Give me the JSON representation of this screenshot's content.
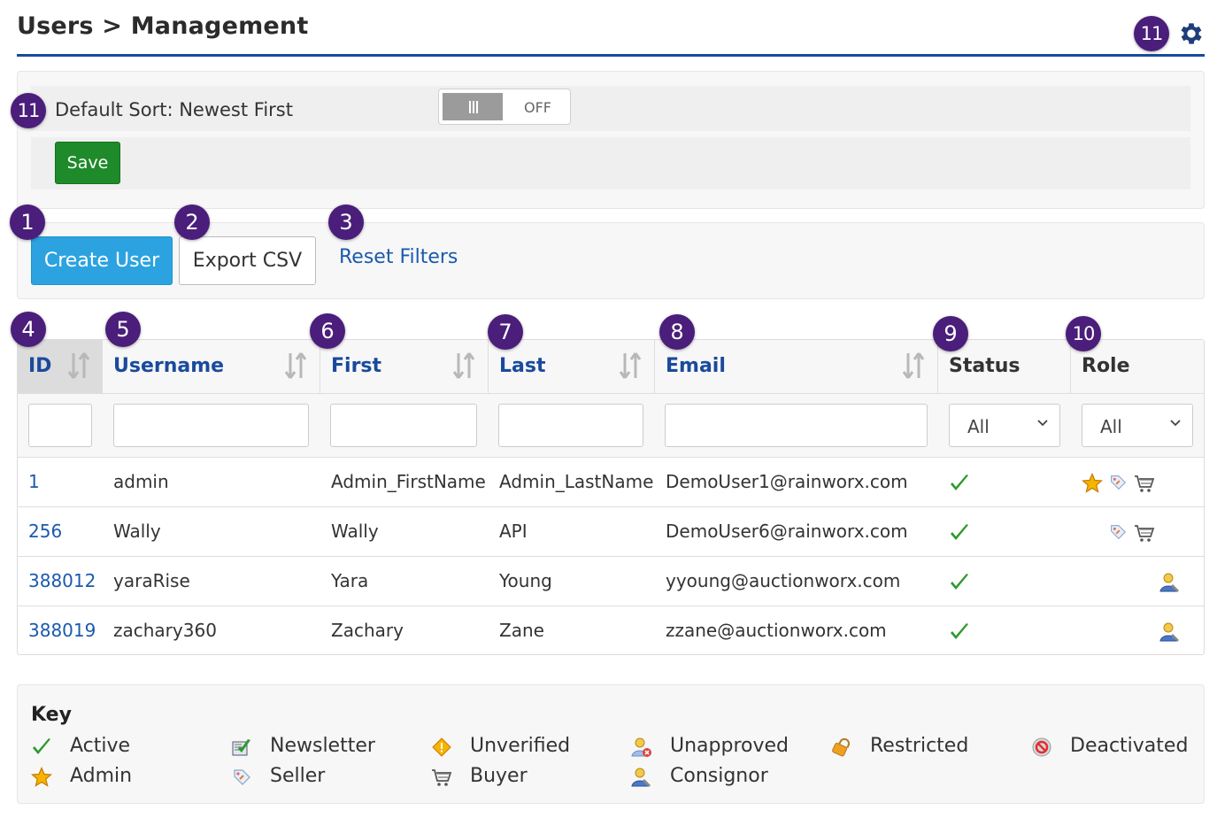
{
  "header": {
    "title": "Users > Management",
    "settings_badge": "11"
  },
  "settings": {
    "badge": "11",
    "sort_label": "Default Sort: Newest First",
    "toggle_state": "OFF",
    "save_label": "Save"
  },
  "actions": {
    "create_badge": "1",
    "create_label": "Create User",
    "export_badge": "2",
    "export_label": "Export CSV",
    "reset_badge": "3",
    "reset_label": "Reset Filters"
  },
  "table": {
    "columns": [
      {
        "badge": "4",
        "label": "ID"
      },
      {
        "badge": "5",
        "label": "Username"
      },
      {
        "badge": "6",
        "label": "First"
      },
      {
        "badge": "7",
        "label": "Last"
      },
      {
        "badge": "8",
        "label": "Email"
      },
      {
        "badge": "9",
        "label": "Status"
      },
      {
        "badge": "10",
        "label": "Role"
      }
    ],
    "status_filter": "All",
    "role_filter": "All",
    "rows": [
      {
        "id": "1",
        "username": "admin",
        "first": "Admin_FirstName",
        "last": "Admin_LastName",
        "email": "DemoUser1@rainworx.com",
        "status": "active-icon",
        "roles": [
          "admin-icon",
          "seller-icon",
          "buyer-icon"
        ]
      },
      {
        "id": "256",
        "username": "Wally",
        "first": "Wally",
        "last": "API",
        "email": "DemoUser6@rainworx.com",
        "status": "active-icon",
        "roles": [
          "seller-icon",
          "buyer-icon"
        ]
      },
      {
        "id": "388012",
        "username": "yaraRise",
        "first": "Yara",
        "last": "Young",
        "email": "yyoung@auctionworx.com",
        "status": "active-icon",
        "roles": [
          "consignor-icon"
        ]
      },
      {
        "id": "388019",
        "username": "zachary360",
        "first": "Zachary",
        "last": "Zane",
        "email": "zzane@auctionworx.com",
        "status": "active-icon",
        "roles": [
          "consignor-icon"
        ]
      }
    ]
  },
  "key": {
    "title": "Key",
    "items": [
      {
        "icon": "active-icon",
        "label": "Active"
      },
      {
        "icon": "newsletter-icon",
        "label": "Newsletter"
      },
      {
        "icon": "unverified-icon",
        "label": "Unverified"
      },
      {
        "icon": "unapproved-icon",
        "label": "Unapproved"
      },
      {
        "icon": "restricted-icon",
        "label": "Restricted"
      },
      {
        "icon": "deactivated-icon",
        "label": "Deactivated"
      },
      {
        "icon": "admin-icon",
        "label": "Admin"
      },
      {
        "icon": "seller-icon",
        "label": "Seller"
      },
      {
        "icon": "buyer-icon",
        "label": "Buyer"
      },
      {
        "icon": "consignor-icon",
        "label": "Consignor"
      }
    ]
  },
  "colors": {
    "badge": "#4a1e7a",
    "link": "#1a5aad",
    "primary_button": "#2ca3e0",
    "save_button": "#1e8a2a",
    "title_rule": "#1a4a9c",
    "active_check": "#2e9a2e"
  }
}
